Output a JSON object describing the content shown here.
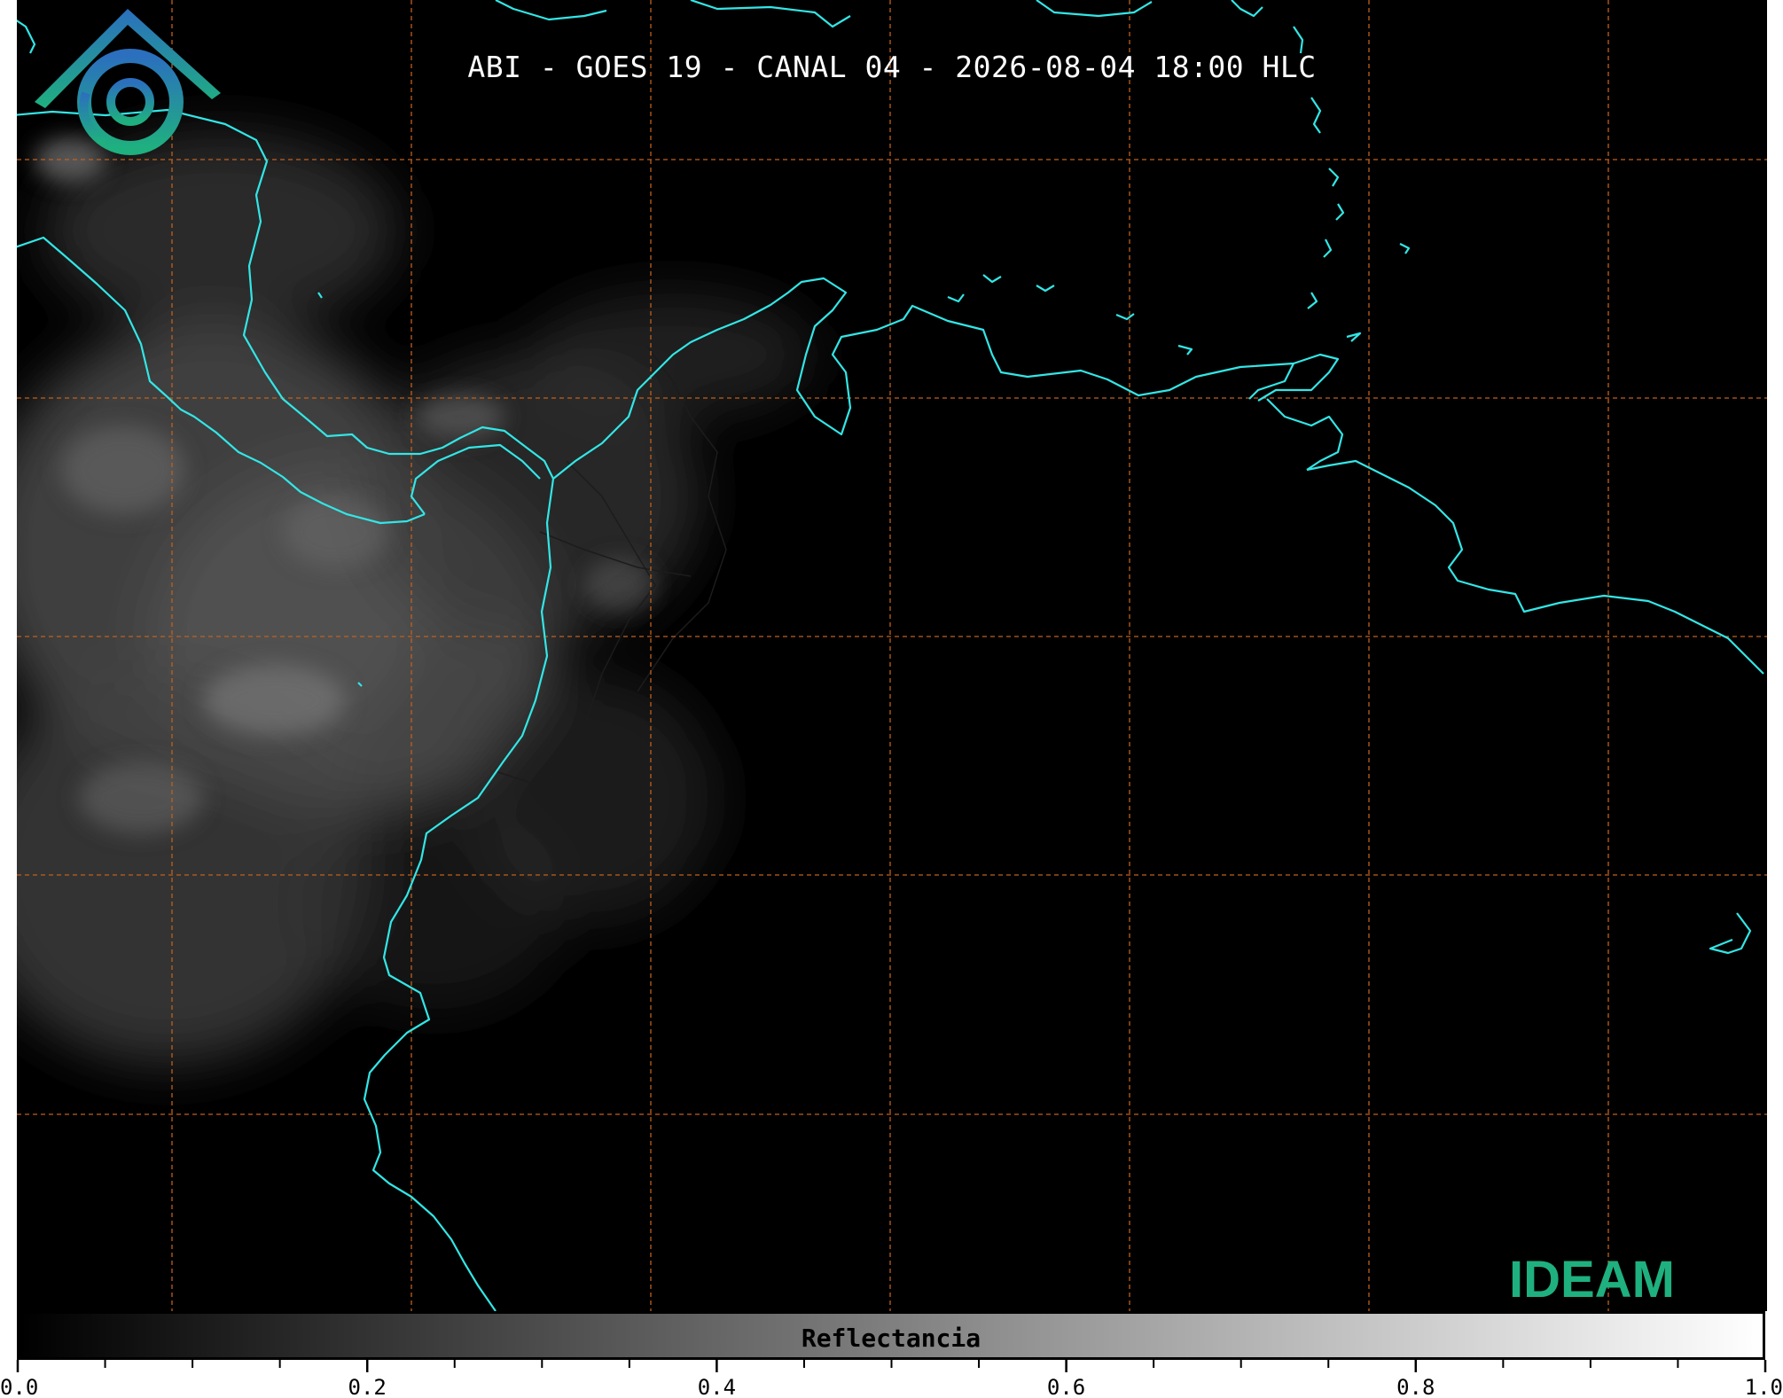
{
  "title": "ABI - GOES 19 - CANAL 04 - 2026-08-04 18:00 HLC",
  "logo": {
    "name": "IDEAM",
    "icon": "ideam-logo-icon"
  },
  "colorbar": {
    "label": "Reflectancia",
    "range": [
      0.0,
      1.0
    ],
    "major_tick_values": [
      0.0,
      0.2,
      0.4,
      0.6,
      0.8,
      1.0
    ],
    "tick_labels": [
      "0.0",
      "0.2",
      "0.4",
      "0.6",
      "0.8",
      "1.0"
    ],
    "minor_tick_step": 0.05,
    "colormap": [
      "#000000",
      "#ffffff"
    ]
  },
  "map": {
    "background": "#000000",
    "coastline_color": "#33e6e6",
    "border_color": "#222222",
    "grid_color": "#c0601c",
    "grid_style": "dashed"
  }
}
